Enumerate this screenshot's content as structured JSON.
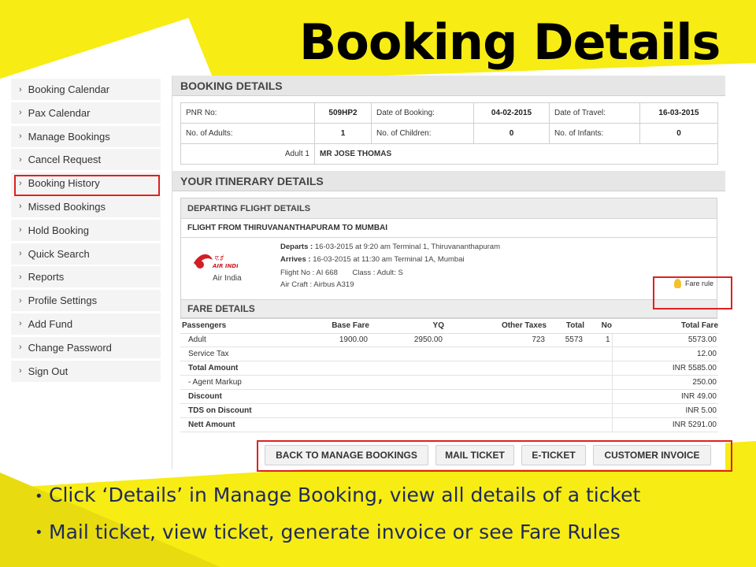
{
  "slide": {
    "title": "Booking Details",
    "bullets": [
      "Click ‘Details’ in Manage Booking, view all details of a ticket",
      "Mail ticket, view ticket, generate invoice or see Fare Rules"
    ],
    "accent_color": "#f7ec14",
    "highlight_color": "#e02020"
  },
  "sidebar": {
    "items": [
      {
        "label": "Booking Calendar"
      },
      {
        "label": "Pax Calendar"
      },
      {
        "label": "Manage Bookings"
      },
      {
        "label": "Cancel Request"
      },
      {
        "label": "Booking History"
      },
      {
        "label": "Missed Bookings"
      },
      {
        "label": "Hold Booking"
      },
      {
        "label": "Quick Search"
      },
      {
        "label": "Reports"
      },
      {
        "label": "Profile Settings"
      },
      {
        "label": "Add Fund"
      },
      {
        "label": "Change Password"
      },
      {
        "label": "Sign Out"
      }
    ]
  },
  "booking": {
    "header": "BOOKING DETAILS",
    "pnr_label": "PNR No:",
    "pnr": "509HP2",
    "date_booking_label": "Date of Booking:",
    "date_booking": "04-02-2015",
    "date_travel_label": "Date of Travel:",
    "date_travel": "16-03-2015",
    "adults_label": "No. of Adults:",
    "adults": "1",
    "children_label": "No. of Children:",
    "children": "0",
    "infants_label": "No. of Infants:",
    "infants": "0",
    "pax_label": "Adult 1",
    "pax_name": "MR JOSE THOMAS"
  },
  "itinerary": {
    "header": "YOUR ITINERARY DETAILS",
    "departing_header": "DEPARTING FLIGHT DETAILS",
    "route": "FLIGHT FROM THIRUVANANTHAPURAM TO MUMBAI",
    "airline": "Air India",
    "departs_label": "Departs :",
    "departs": "16-03-2015 at 9:20 am Terminal 1, Thiruvananthapuram",
    "arrives_label": "Arrives :",
    "arrives": "16-03-2015 at 11:30 am Terminal 1A, Mumbai",
    "flight_no_label": "Flight No :",
    "flight_no": "AI 668",
    "class_label": "Class :",
    "class": "Adult: S",
    "aircraft_label": "Air Craft :",
    "aircraft": "Airbus A319",
    "fare_rule": "Fare rule"
  },
  "fare": {
    "header": "FARE DETAILS",
    "columns": [
      "Passengers",
      "Base Fare",
      "YQ",
      "Other Taxes",
      "Total",
      "No",
      "Total Fare"
    ],
    "row": {
      "pax": "Adult",
      "base": "1900.00",
      "yq": "2950.00",
      "other": "723",
      "total": "5573",
      "no": "1",
      "total_fare": "5573.00"
    },
    "summary": [
      {
        "label": "Service Tax",
        "value": "12.00",
        "bold": false
      },
      {
        "label": "Total Amount",
        "value": "INR 5585.00",
        "bold": true
      },
      {
        "label": "- Agent Markup",
        "value": "250.00",
        "bold": false
      },
      {
        "label": "Discount",
        "value": "INR 49.00",
        "bold": true
      },
      {
        "label": "TDS on Discount",
        "value": "INR 5.00",
        "bold": true
      },
      {
        "label": "Nett Amount",
        "value": "INR 5291.00",
        "bold": true
      }
    ]
  },
  "actions": {
    "back": "BACK TO MANAGE BOOKINGS",
    "mail": "MAIL TICKET",
    "eticket": "E-TICKET",
    "invoice": "CUSTOMER INVOICE"
  }
}
